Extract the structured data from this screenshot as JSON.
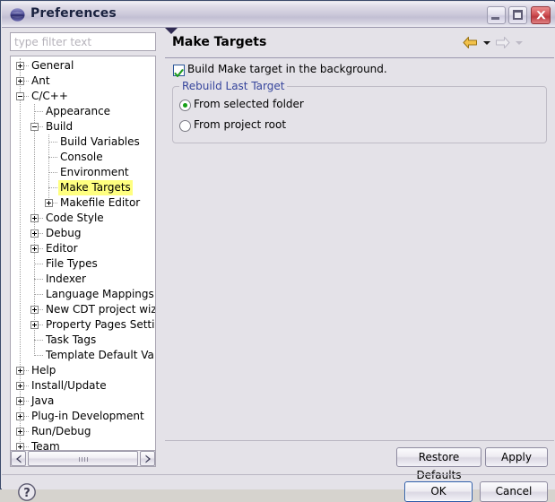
{
  "window": {
    "title": "Preferences",
    "icon": "eclipse-icon",
    "minimize_tooltip": "Minimize",
    "maximize_tooltip": "Maximize",
    "close_tooltip": "Close"
  },
  "filter": {
    "placeholder": "type filter text",
    "value": ""
  },
  "tree": {
    "selected": "Make Targets",
    "items": [
      {
        "label": "General",
        "depth": 0,
        "expander": "plus"
      },
      {
        "label": "Ant",
        "depth": 0,
        "expander": "plus"
      },
      {
        "label": "C/C++",
        "depth": 0,
        "expander": "minus"
      },
      {
        "label": "Appearance",
        "depth": 1,
        "expander": "none"
      },
      {
        "label": "Build",
        "depth": 1,
        "expander": "minus"
      },
      {
        "label": "Build Variables",
        "depth": 2,
        "expander": "none"
      },
      {
        "label": "Console",
        "depth": 2,
        "expander": "none"
      },
      {
        "label": "Environment",
        "depth": 2,
        "expander": "none"
      },
      {
        "label": "Make Targets",
        "depth": 2,
        "expander": "none",
        "selected": true
      },
      {
        "label": "Makefile Editor",
        "depth": 2,
        "expander": "plus"
      },
      {
        "label": "Code Style",
        "depth": 1,
        "expander": "plus"
      },
      {
        "label": "Debug",
        "depth": 1,
        "expander": "plus"
      },
      {
        "label": "Editor",
        "depth": 1,
        "expander": "plus"
      },
      {
        "label": "File Types",
        "depth": 1,
        "expander": "none"
      },
      {
        "label": "Indexer",
        "depth": 1,
        "expander": "none"
      },
      {
        "label": "Language Mappings",
        "depth": 1,
        "expander": "none"
      },
      {
        "label": "New CDT project wizard",
        "depth": 1,
        "expander": "plus"
      },
      {
        "label": "Property Pages Settings",
        "depth": 1,
        "expander": "plus"
      },
      {
        "label": "Task Tags",
        "depth": 1,
        "expander": "none"
      },
      {
        "label": "Template Default Values",
        "depth": 1,
        "expander": "none"
      },
      {
        "label": "Help",
        "depth": 0,
        "expander": "plus"
      },
      {
        "label": "Install/Update",
        "depth": 0,
        "expander": "plus"
      },
      {
        "label": "Java",
        "depth": 0,
        "expander": "plus"
      },
      {
        "label": "Plug-in Development",
        "depth": 0,
        "expander": "plus"
      },
      {
        "label": "Run/Debug",
        "depth": 0,
        "expander": "plus"
      },
      {
        "label": "Team",
        "depth": 0,
        "expander": "plus"
      }
    ]
  },
  "page": {
    "title": "Make Targets",
    "nav": {
      "back_icon": "back-arrow-icon",
      "back_menu_icon": "chevron-down-icon",
      "forward_icon": "forward-arrow-icon",
      "forward_menu_icon": "chevron-down-icon",
      "menu_icon": "chevron-down-icon"
    },
    "checkbox": {
      "label": "Build Make target in the background.",
      "checked": true
    },
    "group": {
      "title": "Rebuild Last Target",
      "title_color": "#36459c",
      "radios": [
        {
          "label": "From selected folder",
          "selected": true
        },
        {
          "label": "From project root",
          "selected": false
        }
      ]
    },
    "buttons": {
      "restore_defaults": "Restore Defaults",
      "apply": "Apply"
    }
  },
  "footer": {
    "help_icon": "help-question-icon",
    "ok": "OK",
    "cancel": "Cancel"
  },
  "scrollbar": {
    "left_icon": "scroll-left-icon",
    "right_icon": "scroll-right-icon"
  },
  "colors": {
    "selection_highlight": "#ffff80",
    "group_title": "#36459c",
    "dialog_bg": "#e4e2e8",
    "checkbox_border": "#2a5699",
    "radio_dot": "#16a016",
    "close_button": "#bc3a3f"
  }
}
